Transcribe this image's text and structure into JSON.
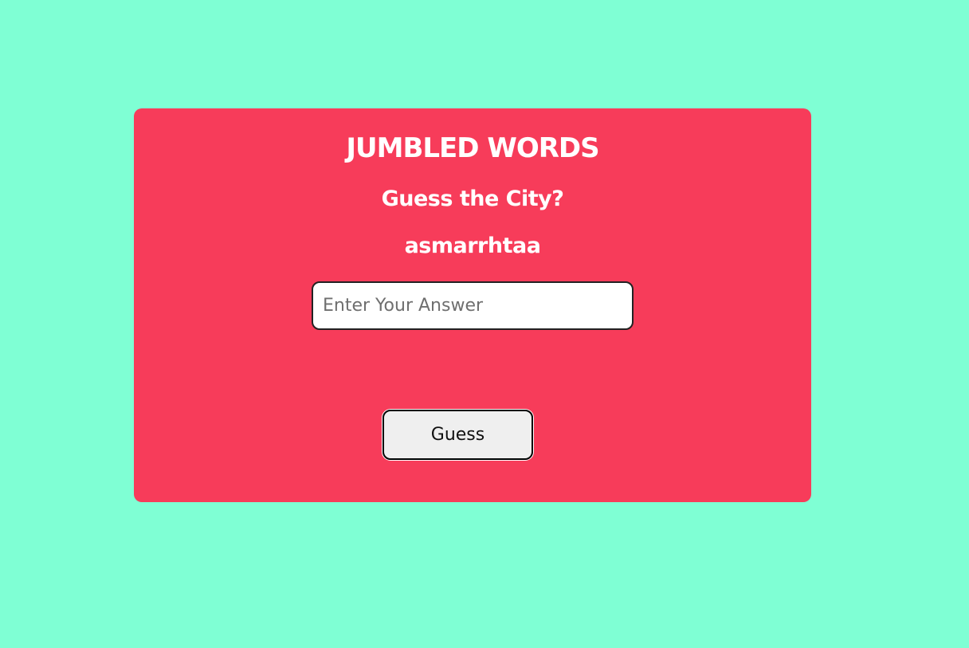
{
  "game": {
    "title": "JUMBLED WORDS",
    "prompt": "Guess the City?",
    "scrambled_word": "asmarrhtaa"
  },
  "answer_field": {
    "placeholder": "Enter Your Answer",
    "value": ""
  },
  "actions": {
    "guess_label": "Guess"
  },
  "colors": {
    "page_background": "#7fffd4",
    "card_background": "#f73c5a",
    "text": "#ffffff",
    "button_background": "#efefef"
  }
}
